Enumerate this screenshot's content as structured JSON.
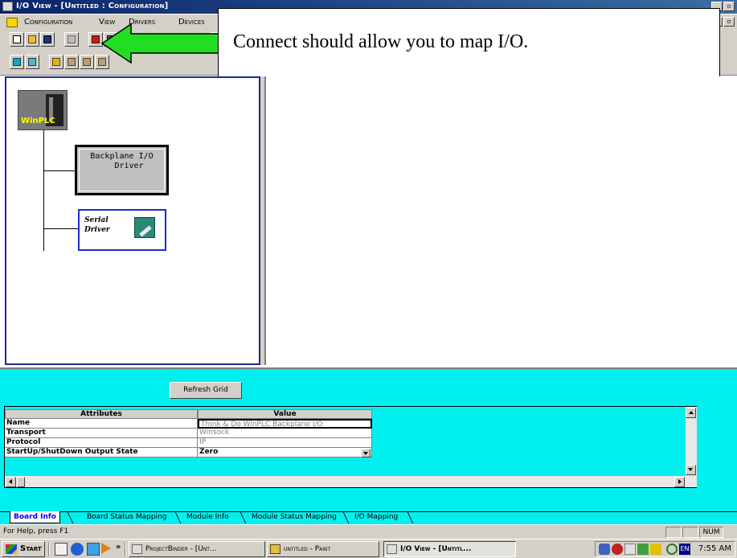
{
  "window": {
    "title": "I/O View - [Untitled : Configuration]"
  },
  "menu": {
    "items": [
      "Configuration",
      "View",
      "Drivers",
      "Devices"
    ]
  },
  "callout": {
    "text": "Connect should allow you to map I/O."
  },
  "tree": {
    "root_label": "WinPLC",
    "backplane_label": "Backplane I/O\n   Driver",
    "serial_label": "Serial\nDriver"
  },
  "bottom": {
    "refresh_button": "Refresh Grid",
    "grid": {
      "headers": [
        "Attributes",
        "Value"
      ],
      "rows": [
        {
          "attribute": "Name",
          "value": "Think & Do WinPLC Backplane I/O"
        },
        {
          "attribute": "Transport",
          "value": "Winsock"
        },
        {
          "attribute": "Protocol",
          "value": "IP"
        },
        {
          "attribute": "StartUp/ShutDown Output State",
          "value": "Zero"
        }
      ]
    },
    "tabs": [
      "Board Info",
      "Board Status Mapping",
      "Module Info",
      "Module Status Mapping",
      "I/O Mapping"
    ],
    "active_tab": "Board Info"
  },
  "status": {
    "help_text": "For Help, press F1",
    "num_indicator": "NUM"
  },
  "taskbar": {
    "start_label": "Start",
    "chevron": "»",
    "tasks": [
      {
        "label": "ProjectBinder - [Unt..."
      },
      {
        "label": "untitled - Paint"
      },
      {
        "label": "I/O View - [Untitl..."
      }
    ],
    "tray_lang": "EN",
    "clock": "7:55 AM"
  },
  "colors": {
    "titlebar": "#0a246a",
    "bottom_panel": "#00f0f0",
    "arrow": "#22dd22",
    "tree_border": "#1e2b8c"
  }
}
